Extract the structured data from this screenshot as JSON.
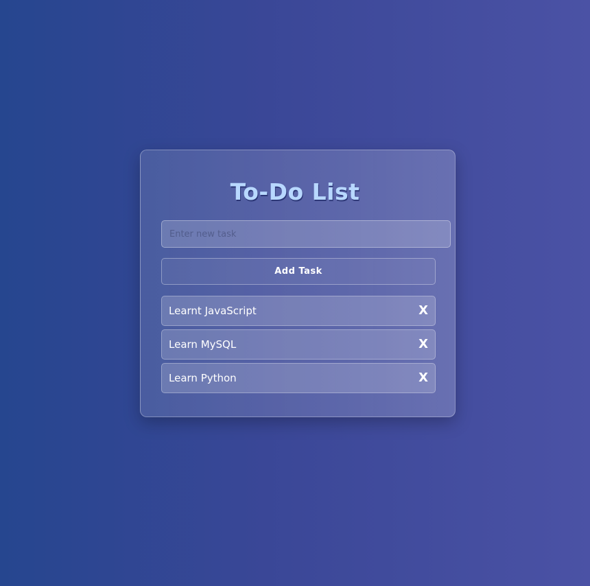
{
  "app": {
    "title": "To-Do List"
  },
  "form": {
    "input_value": "",
    "input_placeholder": "Enter new task",
    "add_button_label": "Add Task"
  },
  "tasks": [
    {
      "text": "Learnt JavaScript",
      "delete_label": "X"
    },
    {
      "text": "Learn MySQL",
      "delete_label": "X"
    },
    {
      "text": "Learn Python",
      "delete_label": "X"
    }
  ],
  "colors": {
    "background_start": "#26468f",
    "background_end": "#4b52a5",
    "title": "#b8d8ff",
    "text": "#ffffff"
  }
}
